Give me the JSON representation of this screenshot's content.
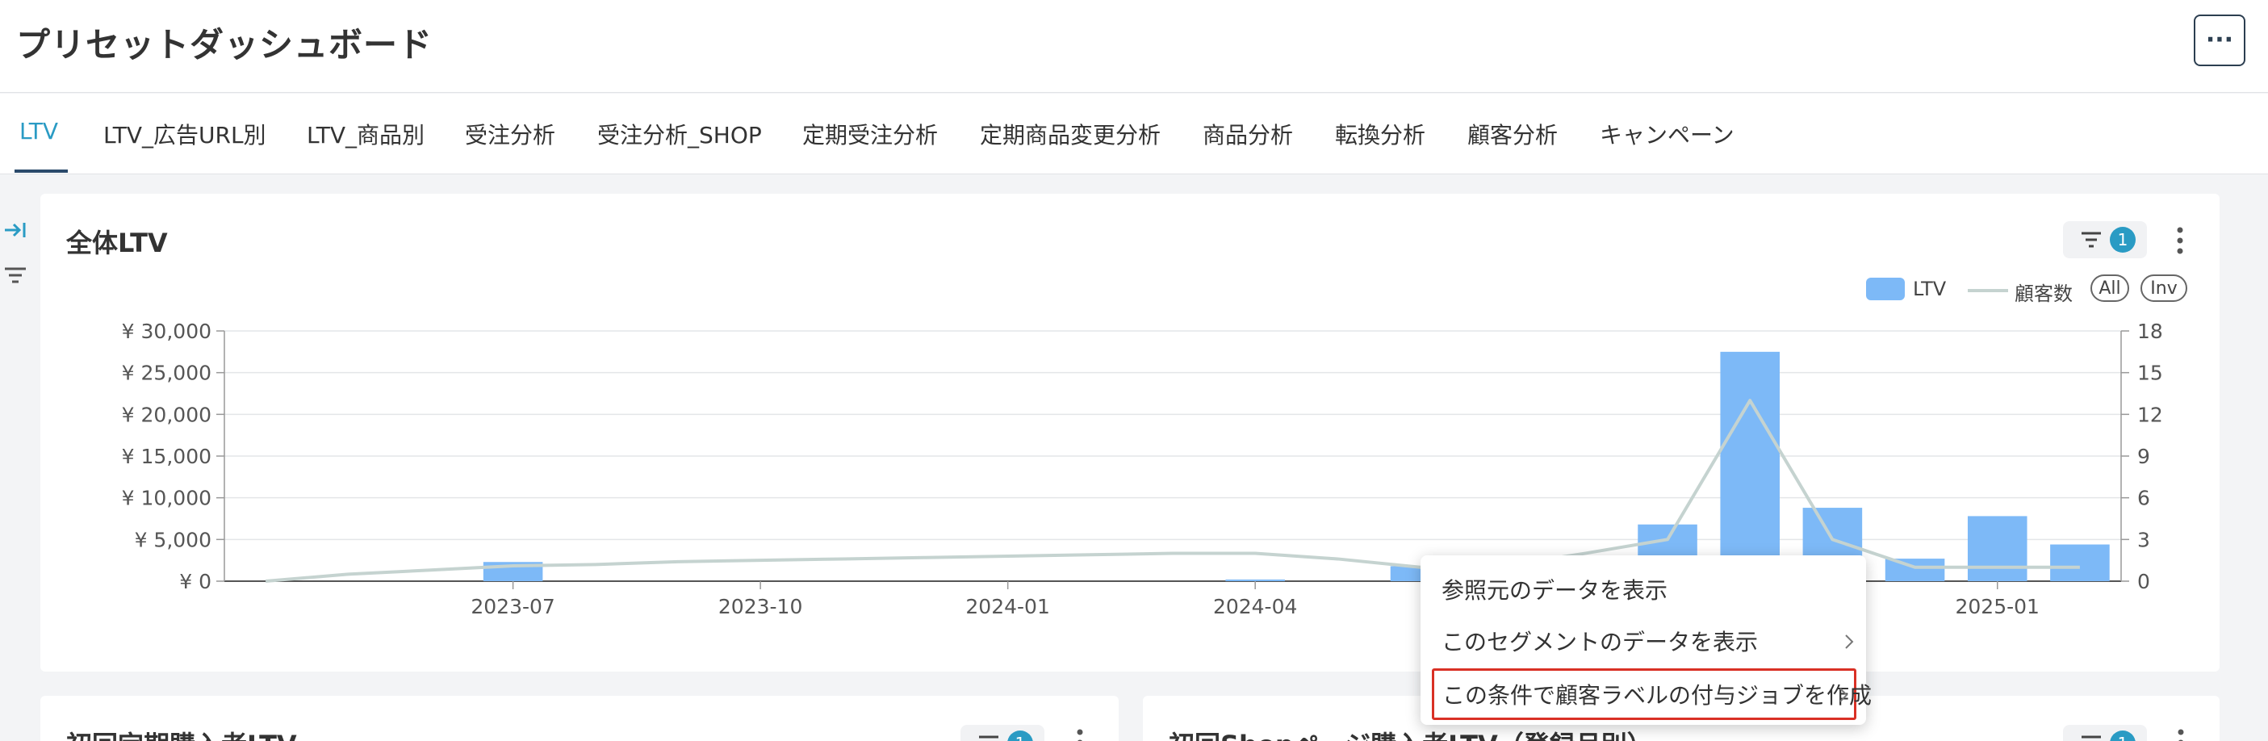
{
  "header": {
    "title": "プリセットダッシュボード",
    "more_label": "···"
  },
  "tabs": [
    {
      "label": "LTV",
      "active": true
    },
    {
      "label": "LTV_広告URL別"
    },
    {
      "label": "LTV_商品別"
    },
    {
      "label": "受注分析"
    },
    {
      "label": "受注分析_SHOP"
    },
    {
      "label": "定期受注分析"
    },
    {
      "label": "定期商品変更分析"
    },
    {
      "label": "商品分析"
    },
    {
      "label": "転換分析"
    },
    {
      "label": "顧客分析"
    },
    {
      "label": "キャンペーン"
    }
  ],
  "sidebar": {
    "expand_icon": "expand-right-icon",
    "filter_icon": "filter-icon"
  },
  "main_card": {
    "title": "全体LTV",
    "filter_count": "1",
    "legend": {
      "bar_series": "LTV",
      "line_series": "顧客数",
      "all_label": "All",
      "inv_label": "Inv"
    }
  },
  "bottom_cards": [
    {
      "title": "初回定期購入者LTV",
      "filter_count": "1"
    },
    {
      "title": "初回Shopページ購入者LTV（登録月別）",
      "filter_count": "1"
    }
  ],
  "context_menu": {
    "items": [
      {
        "label": "参照元のデータを表示",
        "has_submenu": false
      },
      {
        "label": "このセグメントのデータを表示",
        "has_submenu": true
      },
      {
        "label": "この条件で顧客ラベルの付与ジョブを作成",
        "has_submenu": true,
        "highlighted": true
      }
    ]
  },
  "colors": {
    "bar": "#7db9f7",
    "line": "#c5d3d0",
    "accent": "#2a9bc4",
    "highlight": "#d93025"
  },
  "chart_data": {
    "type": "bar",
    "x": [
      "2023-04",
      "2023-05",
      "2023-06",
      "2023-07",
      "2023-08",
      "2023-09",
      "2023-10",
      "2023-11",
      "2023-12",
      "2024-01",
      "2024-02",
      "2024-03",
      "2024-04",
      "2024-05",
      "2024-06",
      "2024-07",
      "2024-08",
      "2024-09",
      "2024-10",
      "2024-11",
      "2024-12",
      "2025-01",
      "2025-02"
    ],
    "xticks": [
      "2023-07",
      "2023-10",
      "2024-01",
      "2024-04",
      "2025-01"
    ],
    "series": [
      {
        "name": "LTV",
        "type": "bar",
        "axis": "left",
        "values": [
          0,
          0,
          0,
          2300,
          0,
          0,
          0,
          0,
          0,
          0,
          0,
          0,
          200,
          0,
          1800,
          0,
          0,
          6800,
          27500,
          8800,
          2700,
          7800,
          4400
        ]
      },
      {
        "name": "顧客数",
        "type": "line",
        "axis": "right",
        "values": [
          0,
          0.5,
          0.8,
          1.1,
          1.2,
          1.4,
          1.5,
          1.6,
          1.7,
          1.8,
          1.9,
          2.0,
          2.0,
          1.6,
          1.0,
          1.1,
          2.0,
          3.0,
          13.0,
          3.0,
          1.0,
          1.0,
          1.0
        ]
      }
    ],
    "y_left": {
      "min": 0,
      "max": 30000,
      "ticks": [
        "¥ 0",
        "¥ 5,000",
        "¥ 10,000",
        "¥ 15,000",
        "¥ 20,000",
        "¥ 25,000",
        "¥ 30,000"
      ]
    },
    "y_right": {
      "min": 0,
      "max": 18,
      "ticks": [
        "0",
        "3",
        "6",
        "9",
        "12",
        "15",
        "18"
      ]
    },
    "grid": true,
    "legend_position": "top-right"
  }
}
